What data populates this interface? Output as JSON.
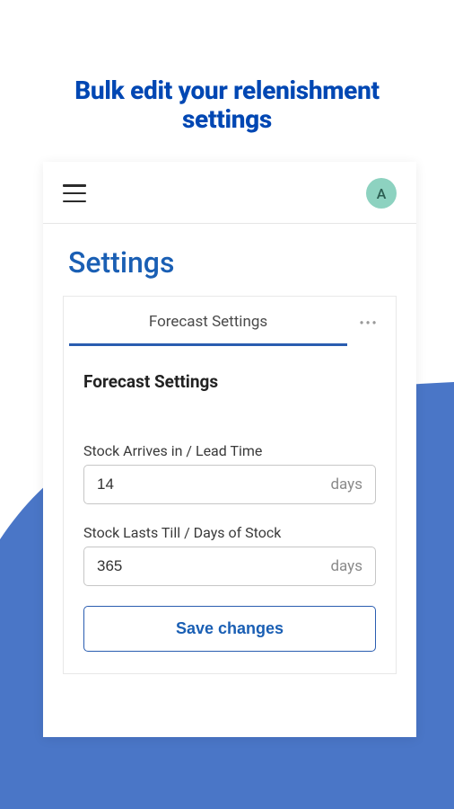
{
  "hero": {
    "title_line1": "Bulk edit your relenishment",
    "title_line2": "settings"
  },
  "topbar": {
    "avatar_initial": "A"
  },
  "page": {
    "title": "Settings"
  },
  "tabs": {
    "active": "Forecast Settings"
  },
  "section": {
    "title": "Forecast Settings"
  },
  "fields": {
    "lead_time": {
      "label": "Stock Arrives in / Lead Time",
      "value": "14",
      "unit": "days"
    },
    "days_of_stock": {
      "label": "Stock Lasts Till / Days of Stock",
      "value": "365",
      "unit": "days"
    }
  },
  "actions": {
    "save": "Save changes"
  },
  "colors": {
    "primary": "#1a5fb4",
    "tab_underline": "#2a5db0",
    "bg_wave": "#4a76c7",
    "avatar_bg": "#8dd2c0"
  }
}
